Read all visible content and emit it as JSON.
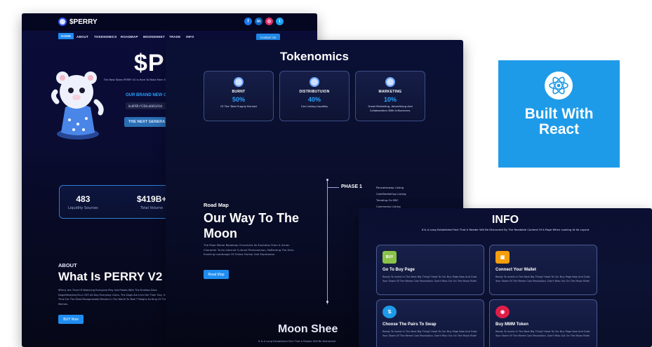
{
  "landing": {
    "logo_text": "$PERRY",
    "socials": [
      {
        "icon": "facebook-icon",
        "glyph": "f",
        "color": "#1877f2"
      },
      {
        "icon": "linkedin-icon",
        "glyph": "in",
        "color": "#0a66c2"
      },
      {
        "icon": "instagram-icon",
        "glyph": "◎",
        "color": "#e1306c"
      },
      {
        "icon": "twitter-icon",
        "glyph": "t",
        "color": "#1da1f2"
      }
    ],
    "nav": [
      "HOME",
      "ABOUT",
      "TOKENOMICS",
      "ROADMAP",
      "MOONSHEET",
      "TRADE",
      "INFO"
    ],
    "contact_label": "Contact Us",
    "hero_title": "$PE",
    "hero_sub": "The New Token PERRY V2 Is Here To Make Mem Existence. The PERRY Have Had Their",
    "brand_new": "OUR BRAND NEW C",
    "address": "0x0PERrY2E0cd001b50d",
    "next_label": "THE NEXT GENERA",
    "stats": [
      {
        "value": "483",
        "label": "Liquidity Sources"
      },
      {
        "value": "$419B+",
        "label": "Total Volume"
      }
    ],
    "about_kicker": "ABOUT",
    "about_title": "What Is PERRY V2",
    "about_text": "$Perry Are Tired Of Watching Everyone Play Hot Potato With The Endless Dera Dogelifestyles/OLur CEO All Day Everyday Coins. The Dogs Are Inch Her Their Day. It's Time For The Most Recognizable Memes In The World To Take T Reigns As King Of The Memes.",
    "buy_label": "BUY Now"
  },
  "tokenomics": {
    "title": "Tokenomics",
    "cards": [
      {
        "name": "BURNT",
        "pct": "50%",
        "desc": "Of The Total Supply Burned"
      },
      {
        "name": "DISTRIBUTUION",
        "pct": "40%",
        "desc": "Cex Listing Liquidity"
      },
      {
        "name": "MARKETING",
        "pct": "10%",
        "desc": "Great Marketing, Advertising And Collaboration With Influencers."
      }
    ],
    "roadmap_kicker": "Road Map",
    "roadmap_title": "Our Way To The Moon",
    "roadmap_text": "The Pepe Meme Roadmap Chronicles Its Evolution From A 4chan Character To An Internet Cultural Phenomenon, Reflecting The Ever-Evolving Landscape Of Online Humor And Expression.",
    "roadmap_btn": "Read Map",
    "phase_label": "PHASE 1",
    "phase_items": [
      "Pancakeswap Listing",
      "CoinMarketCap Listing",
      "Trending On BSC",
      "Coinmecko Listing"
    ],
    "moon_title": "Moon Shee",
    "moon_sub": "It Is A Long Established Fact That A Reader Will Be Distracted"
  },
  "info": {
    "title": "INFO",
    "subtitle": "It Is A Long Established Fact That A Reader Will Be Distracted By The Readable Content Of A Page When Looking At Its Layout",
    "cards": [
      {
        "title": "Go To Buy Page",
        "icon": "buy-icon",
        "glyph": "BUY",
        "color": "#8bc34a",
        "desc": "Ready To Invest In The Next Big Thing? Head To Our Buy Page Now And Grab Your Share Of The Meme Coin Revolution. Don't Miss Out On The Moon Ride!"
      },
      {
        "title": "Connect Your Wallet",
        "icon": "wallet-icon",
        "glyph": "▣",
        "color": "#f59e0b",
        "desc": "Ready To Invest In The Next Big Thing? Head To Our Buy Page Now And Grab Your Share Of The Meme Coin Revolution. Don't Miss Out On The Moon Ride!"
      },
      {
        "title": "Choose The Pairs To Swap",
        "icon": "swap-icon",
        "glyph": "⇅",
        "color": "#1e9be8",
        "desc": "Ready To Invest In The Next Big Thing? Head To Our Buy Page Now And Grab Your Share Of The Meme Coin Revolution. Don't Miss Out On The Moon Ride!"
      },
      {
        "title": "Buy MMM Token",
        "icon": "token-icon",
        "glyph": "◉",
        "color": "#e11d48",
        "desc": "Ready To Invest In The Next Big Thing? Head To Our Buy Page Now And Grab Your Share Of The Meme Coin Revolution. Don't Miss Out On The Moon Ride!"
      }
    ]
  },
  "badge": {
    "line1": "Built With",
    "line2": "React"
  }
}
